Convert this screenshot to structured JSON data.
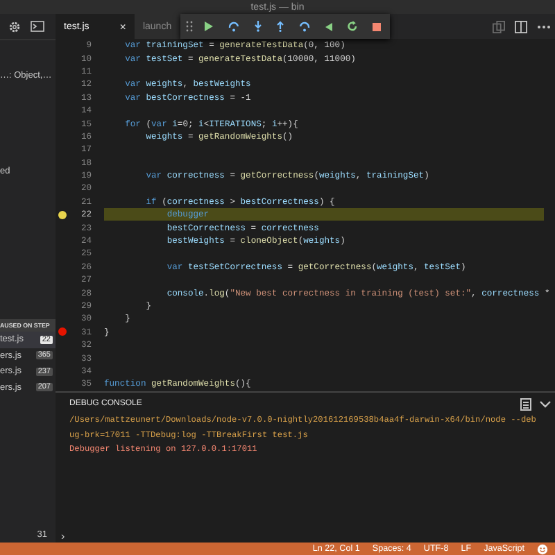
{
  "window": {
    "title": "test.js — bin"
  },
  "sidebar": {
    "variables": [
      "…: Object,…",
      "ed"
    ],
    "paused_label": "AUSED ON STEP",
    "call_stack": [
      {
        "file": "test.js",
        "line": "22",
        "selected": true
      },
      {
        "file": "ers.js",
        "line": "365",
        "selected": false
      },
      {
        "file": "ers.js",
        "line": "237",
        "selected": false
      },
      {
        "file": "ers.js",
        "line": "207",
        "selected": false
      }
    ],
    "count": "31"
  },
  "tabs": [
    {
      "label": "test.js",
      "selected": true,
      "close": "×"
    },
    {
      "label": "launch",
      "selected": false
    }
  ],
  "debug_toolbar": [
    {
      "kind": "continue"
    },
    {
      "kind": "step-over"
    },
    {
      "kind": "step-into"
    },
    {
      "kind": "step-out"
    },
    {
      "kind": "step-back"
    },
    {
      "kind": "reverse-continue"
    },
    {
      "kind": "restart"
    },
    {
      "kind": "stop"
    }
  ],
  "editor": {
    "lines": [
      {
        "number": "9",
        "current": false,
        "paused": false,
        "breakpoint": false,
        "tokens": [
          {
            "text": "    var",
            "kind": "kw"
          },
          {
            "text": " trainingSet",
            "kind": "id"
          },
          {
            "text": " = ",
            "kind": "plain"
          },
          {
            "text": "generateTestData",
            "kind": "fn"
          },
          {
            "text": "(0, 100)",
            "kind": "plain"
          }
        ]
      },
      {
        "number": "10",
        "current": false,
        "paused": false,
        "breakpoint": false,
        "tokens": [
          {
            "text": "    var",
            "kind": "kw"
          },
          {
            "text": " testSet",
            "kind": "id"
          },
          {
            "text": " = ",
            "kind": "plain"
          },
          {
            "text": "generateTestData",
            "kind": "fn"
          },
          {
            "text": "(10000, 11000)",
            "kind": "plain"
          }
        ]
      },
      {
        "number": "11",
        "current": false,
        "paused": false,
        "breakpoint": false
      },
      {
        "number": "12",
        "current": false,
        "paused": false,
        "breakpoint": false,
        "tokens": [
          {
            "text": "    var",
            "kind": "kw"
          },
          {
            "text": " weights",
            "kind": "id"
          },
          {
            "text": ", ",
            "kind": "plain"
          },
          {
            "text": "bestWeights",
            "kind": "id"
          }
        ]
      },
      {
        "number": "13",
        "current": false,
        "paused": false,
        "breakpoint": false,
        "tokens": [
          {
            "text": "    var",
            "kind": "kw"
          },
          {
            "text": " bestCorrectness",
            "kind": "id"
          },
          {
            "text": " = -1",
            "kind": "plain"
          }
        ]
      },
      {
        "number": "14",
        "current": false,
        "paused": false,
        "breakpoint": false
      },
      {
        "number": "15",
        "current": false,
        "paused": false,
        "breakpoint": false,
        "tokens": [
          {
            "text": "    for",
            "kind": "kw"
          },
          {
            "text": " (",
            "kind": "plain"
          },
          {
            "text": "var",
            "kind": "kw"
          },
          {
            "text": " i",
            "kind": "id"
          },
          {
            "text": "=0; ",
            "kind": "plain"
          },
          {
            "text": "i",
            "kind": "id"
          },
          {
            "text": "<",
            "kind": "plain"
          },
          {
            "text": "ITERATIONS",
            "kind": "id"
          },
          {
            "text": "; ",
            "kind": "plain"
          },
          {
            "text": "i",
            "kind": "id"
          },
          {
            "text": "++){",
            "kind": "plain"
          }
        ]
      },
      {
        "number": "16",
        "current": false,
        "paused": false,
        "breakpoint": false,
        "tokens": [
          {
            "text": "        weights",
            "kind": "id"
          },
          {
            "text": " = ",
            "kind": "plain"
          },
          {
            "text": "getRandomWeights",
            "kind": "fn"
          },
          {
            "text": "()",
            "kind": "plain"
          }
        ]
      },
      {
        "number": "17",
        "current": false,
        "paused": false,
        "breakpoint": false
      },
      {
        "number": "18",
        "current": false,
        "paused": false,
        "breakpoint": false
      },
      {
        "number": "19",
        "current": false,
        "paused": false,
        "breakpoint": false,
        "tokens": [
          {
            "text": "        var",
            "kind": "kw"
          },
          {
            "text": " correctness",
            "kind": "id"
          },
          {
            "text": " = ",
            "kind": "plain"
          },
          {
            "text": "getCorrectness",
            "kind": "fn"
          },
          {
            "text": "(",
            "kind": "plain"
          },
          {
            "text": "weights",
            "kind": "id"
          },
          {
            "text": ", ",
            "kind": "plain"
          },
          {
            "text": "trainingSet",
            "kind": "id"
          },
          {
            "text": ")",
            "kind": "plain"
          }
        ]
      },
      {
        "number": "20",
        "current": false,
        "paused": false,
        "breakpoint": false
      },
      {
        "number": "21",
        "current": false,
        "paused": false,
        "breakpoint": false,
        "tokens": [
          {
            "text": "        if",
            "kind": "kw"
          },
          {
            "text": " (",
            "kind": "plain"
          },
          {
            "text": "correctness",
            "kind": "id"
          },
          {
            "text": " > ",
            "kind": "plain"
          },
          {
            "text": "bestCorrectness",
            "kind": "id"
          },
          {
            "text": ") {",
            "kind": "plain"
          }
        ]
      },
      {
        "number": "22",
        "current": true,
        "paused": true,
        "breakpoint": false,
        "tokens": [
          {
            "text": "            debugger",
            "kind": "kw"
          }
        ]
      },
      {
        "number": "23",
        "current": false,
        "paused": false,
        "breakpoint": false,
        "tokens": [
          {
            "text": "            bestCorrectness",
            "kind": "id"
          },
          {
            "text": " = ",
            "kind": "plain"
          },
          {
            "text": "correctness",
            "kind": "id"
          }
        ]
      },
      {
        "number": "24",
        "current": false,
        "paused": false,
        "breakpoint": false,
        "tokens": [
          {
            "text": "            bestWeights",
            "kind": "id"
          },
          {
            "text": " = ",
            "kind": "plain"
          },
          {
            "text": "cloneObject",
            "kind": "fn"
          },
          {
            "text": "(",
            "kind": "plain"
          },
          {
            "text": "weights",
            "kind": "id"
          },
          {
            "text": ")",
            "kind": "plain"
          }
        ]
      },
      {
        "number": "25",
        "current": false,
        "paused": false,
        "breakpoint": false
      },
      {
        "number": "26",
        "current": false,
        "paused": false,
        "breakpoint": false,
        "tokens": [
          {
            "text": "            var",
            "kind": "kw"
          },
          {
            "text": " testSetCorrectness",
            "kind": "id"
          },
          {
            "text": " = ",
            "kind": "plain"
          },
          {
            "text": "getCorrectness",
            "kind": "fn"
          },
          {
            "text": "(",
            "kind": "plain"
          },
          {
            "text": "weights",
            "kind": "id"
          },
          {
            "text": ", ",
            "kind": "plain"
          },
          {
            "text": "testSet",
            "kind": "id"
          },
          {
            "text": ")",
            "kind": "plain"
          }
        ]
      },
      {
        "number": "27",
        "current": false,
        "paused": false,
        "breakpoint": false
      },
      {
        "number": "28",
        "current": false,
        "paused": false,
        "breakpoint": false,
        "tokens": [
          {
            "text": "            console",
            "kind": "id"
          },
          {
            "text": ".",
            "kind": "plain"
          },
          {
            "text": "log",
            "kind": "fn"
          },
          {
            "text": "(",
            "kind": "plain"
          },
          {
            "text": "\"New best correctness in training (test) set:\"",
            "kind": "str"
          },
          {
            "text": ", ",
            "kind": "plain"
          },
          {
            "text": "correctness",
            "kind": "id"
          },
          {
            "text": " *",
            "kind": "plain"
          }
        ]
      },
      {
        "number": "29",
        "current": false,
        "paused": false,
        "breakpoint": false,
        "tokens": [
          {
            "text": "        }",
            "kind": "plain"
          }
        ]
      },
      {
        "number": "30",
        "current": false,
        "paused": false,
        "breakpoint": false,
        "tokens": [
          {
            "text": "    }",
            "kind": "plain"
          }
        ]
      },
      {
        "number": "31",
        "current": false,
        "paused": false,
        "breakpoint": true,
        "tokens": [
          {
            "text": "}",
            "kind": "plain"
          }
        ]
      },
      {
        "number": "32",
        "current": false,
        "paused": false,
        "breakpoint": false
      },
      {
        "number": "33",
        "current": false,
        "paused": false,
        "breakpoint": false
      },
      {
        "number": "34",
        "current": false,
        "paused": false,
        "breakpoint": false
      },
      {
        "number": "35",
        "current": false,
        "paused": false,
        "breakpoint": false,
        "tokens": [
          {
            "text": "function",
            "kind": "kw"
          },
          {
            "text": " getRandomWeights",
            "kind": "fn"
          },
          {
            "text": "(){",
            "kind": "plain"
          }
        ]
      }
    ]
  },
  "debug_console": {
    "title": "DEBUG CONSOLE",
    "lines": [
      {
        "text": "/Users/mattzeunert/Downloads/node-v7.0.0-nightly201612169538b4aa4f-darwin-x64/bin/node --deb",
        "kind": "command"
      },
      {
        "text": "ug-brk=17011 -TTDebug:log -TTBreakFirst test.js",
        "kind": "command"
      },
      {
        "text": "Debugger listening on 127.0.0.1:17011",
        "kind": "error"
      }
    ],
    "prompt": "›"
  },
  "status_bar": {
    "items": [
      "Ln 22, Col 1",
      "Spaces: 4",
      "UTF-8",
      "LF",
      "JavaScript"
    ]
  }
}
